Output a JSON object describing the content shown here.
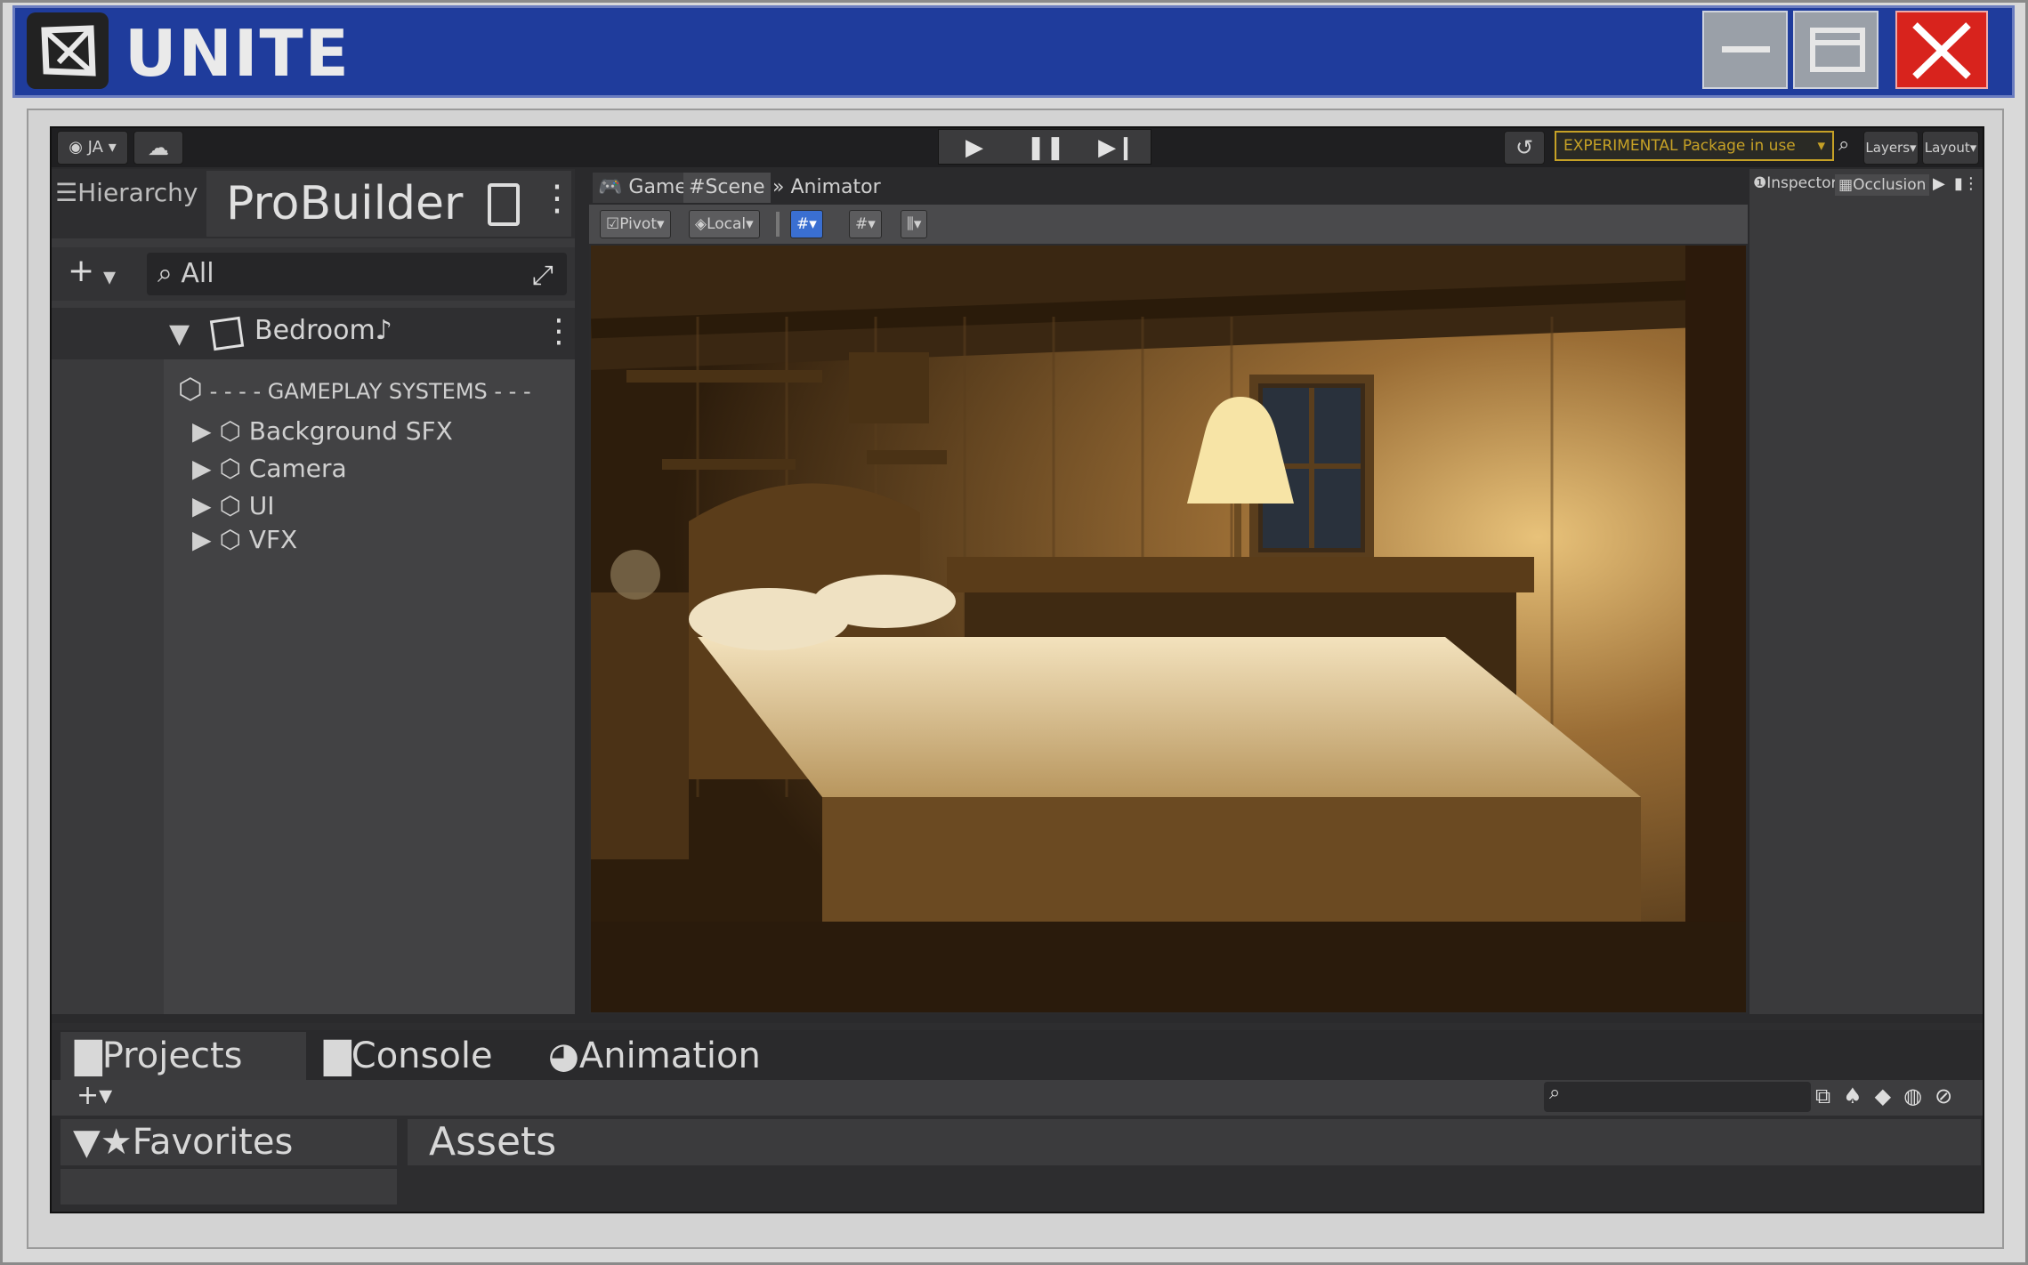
{
  "app": {
    "title": "UNITE",
    "logo_icon": "unity-logo-icon"
  },
  "window_controls": {
    "minimize_icon": "minimize-icon",
    "maximize_icon": "maximize-icon",
    "close_icon": "close-icon",
    "close_color": "#d8231d"
  },
  "toolbar": {
    "account_label": "JA",
    "cloud_icon": "cloud-icon",
    "play_icon": "play-icon",
    "pause_icon": "pause-icon",
    "step_icon": "step-icon",
    "history_icon": "history-icon",
    "experimental_label": "EXPERIMENTAL Package in use",
    "layers_label": "Layers",
    "layout_label": "Layout",
    "accent_warning": "#c6a126"
  },
  "hierarchy": {
    "tab_label": "Hierarchy",
    "probuilder_label": "ProBuilder",
    "search_placeholder": "All",
    "scene_name": "Bedroom",
    "items": [
      {
        "label": "- - - - GAMEPLAY SYSTEMS - - -"
      },
      {
        "label": "Background SFX"
      },
      {
        "label": "Camera"
      },
      {
        "label": "UI"
      },
      {
        "label": "VFX"
      }
    ]
  },
  "scene_view": {
    "tabs": [
      {
        "label": "Game"
      },
      {
        "label": "Scene"
      },
      {
        "label": "Animator"
      }
    ],
    "tools": {
      "pivot": "Pivot",
      "local": "Local"
    },
    "accent_blue": "#3a6fd1"
  },
  "inspector": {
    "tabs": [
      {
        "label": "Inspector"
      },
      {
        "label": "Occlusion"
      }
    ]
  },
  "bottom": {
    "tabs": [
      {
        "label": "Projects"
      },
      {
        "label": "Console"
      },
      {
        "label": "Animation"
      }
    ],
    "favorites_label": "Favorites",
    "assets_label": "Assets"
  }
}
